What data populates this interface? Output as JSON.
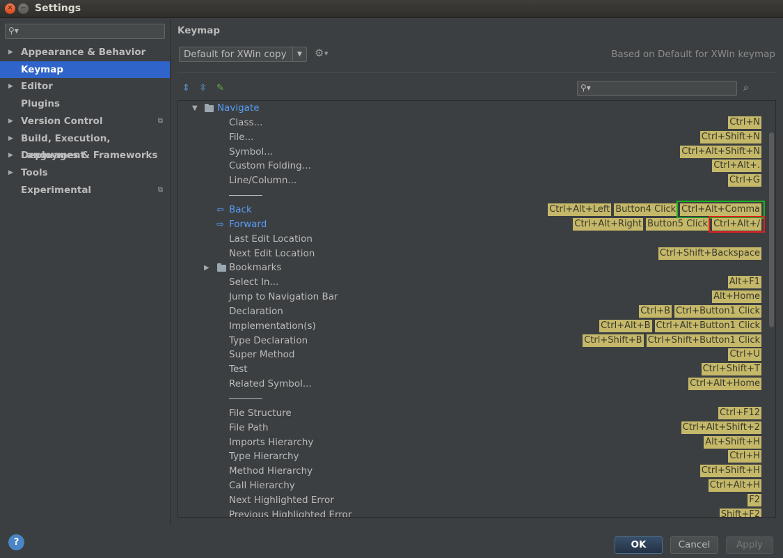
{
  "window": {
    "title": "Settings"
  },
  "sidebar": {
    "items": [
      {
        "label": "Appearance & Behavior",
        "expandable": true
      },
      {
        "label": "Keymap",
        "selected": true
      },
      {
        "label": "Editor",
        "expandable": true
      },
      {
        "label": "Plugins"
      },
      {
        "label": "Version Control",
        "expandable": true,
        "project_icon": true
      },
      {
        "label": "Build, Execution, Deployment",
        "expandable": true
      },
      {
        "label": "Languages & Frameworks",
        "expandable": true
      },
      {
        "label": "Tools",
        "expandable": true
      },
      {
        "label": "Experimental",
        "project_icon": true
      }
    ]
  },
  "main": {
    "title": "Keymap",
    "scheme": "Default for XWin copy",
    "based_on": "Based on Default for XWin keymap"
  },
  "tree": {
    "root": "Navigate",
    "rows": [
      {
        "label": "Class...",
        "shortcuts": [
          "Ctrl+N"
        ]
      },
      {
        "label": "File...",
        "shortcuts": [
          "Ctrl+Shift+N"
        ]
      },
      {
        "label": "Symbol...",
        "shortcuts": [
          "Ctrl+Alt+Shift+N"
        ]
      },
      {
        "label": "Custom Folding...",
        "shortcuts": [
          "Ctrl+Alt+."
        ]
      },
      {
        "label": "Line/Column...",
        "shortcuts": [
          "Ctrl+G"
        ]
      },
      {
        "separator": true
      },
      {
        "label": "Back",
        "icon": "back-arrow-icon",
        "link": true,
        "shortcuts": [
          "Ctrl+Alt+Left",
          "Button4 Click",
          "Ctrl+Alt+Comma"
        ],
        "highlight": "green"
      },
      {
        "label": "Forward",
        "icon": "forward-arrow-icon",
        "link": true,
        "shortcuts": [
          "Ctrl+Alt+Right",
          "Button5 Click",
          "Ctrl+Alt+/"
        ],
        "highlight": "red"
      },
      {
        "label": "Last Edit Location",
        "shortcuts": []
      },
      {
        "label": "Next Edit Location",
        "shortcuts": [
          "Ctrl+Shift+Backspace"
        ]
      },
      {
        "label": "Bookmarks",
        "folder": true,
        "shortcuts": []
      },
      {
        "label": "Select In...",
        "shortcuts": [
          "Alt+F1"
        ]
      },
      {
        "label": "Jump to Navigation Bar",
        "shortcuts": [
          "Alt+Home"
        ]
      },
      {
        "label": "Declaration",
        "shortcuts": [
          "Ctrl+B",
          "Ctrl+Button1 Click"
        ]
      },
      {
        "label": "Implementation(s)",
        "shortcuts": [
          "Ctrl+Alt+B",
          "Ctrl+Alt+Button1 Click"
        ]
      },
      {
        "label": "Type Declaration",
        "shortcuts": [
          "Ctrl+Shift+B",
          "Ctrl+Shift+Button1 Click"
        ]
      },
      {
        "label": "Super Method",
        "shortcuts": [
          "Ctrl+U"
        ]
      },
      {
        "label": "Test",
        "shortcuts": [
          "Ctrl+Shift+T"
        ]
      },
      {
        "label": "Related Symbol...",
        "shortcuts": [
          "Ctrl+Alt+Home"
        ]
      },
      {
        "separator": true
      },
      {
        "label": "File Structure",
        "shortcuts": [
          "Ctrl+F12"
        ]
      },
      {
        "label": "File Path",
        "shortcuts": [
          "Ctrl+Alt+Shift+2"
        ]
      },
      {
        "label": "Imports Hierarchy",
        "shortcuts": [
          "Alt+Shift+H"
        ]
      },
      {
        "label": "Type Hierarchy",
        "shortcuts": [
          "Ctrl+H"
        ]
      },
      {
        "label": "Method Hierarchy",
        "shortcuts": [
          "Ctrl+Shift+H"
        ]
      },
      {
        "label": "Call Hierarchy",
        "shortcuts": [
          "Ctrl+Alt+H"
        ]
      },
      {
        "label": "Next Highlighted Error",
        "shortcuts": [
          "F2"
        ]
      },
      {
        "label": "Previous Highlighted Error",
        "shortcuts": [
          "Shift+F2"
        ]
      }
    ]
  },
  "footer": {
    "help": "?",
    "ok": "OK",
    "cancel": "Cancel",
    "apply": "Apply"
  },
  "colors": {
    "shortcut_bg": "#c5b869",
    "selection": "#2f65ca",
    "link": "#589df6",
    "highlight_green": "#1db21d",
    "highlight_red": "#e02020"
  }
}
